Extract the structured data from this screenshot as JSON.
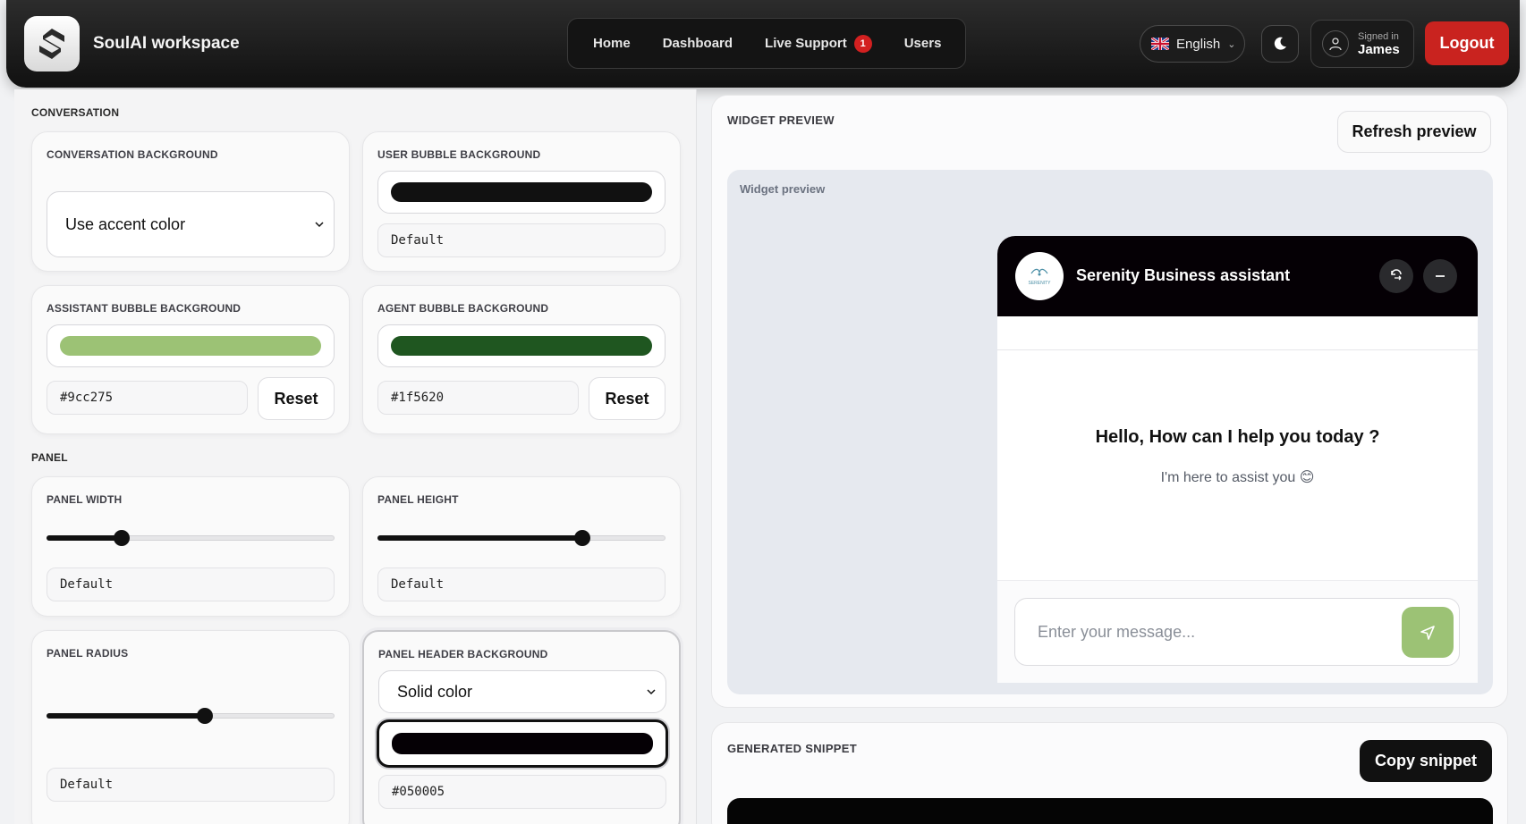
{
  "header": {
    "brand": "SoulAI workspace",
    "nav": [
      {
        "label": "Home"
      },
      {
        "label": "Dashboard"
      },
      {
        "label": "Live Support",
        "badge": "1"
      },
      {
        "label": "Users"
      }
    ],
    "language": "English",
    "signed_in_label": "Signed in",
    "user_name": "James",
    "logout": "Logout"
  },
  "conversation": {
    "section_title": "CONVERSATION",
    "conversation_background": {
      "label": "CONVERSATION BACKGROUND",
      "selected": "Use accent color"
    },
    "user_bubble": {
      "label": "USER BUBBLE BACKGROUND",
      "color": "#111111",
      "value": "Default"
    },
    "assistant_bubble": {
      "label": "ASSISTANT BUBBLE BACKGROUND",
      "color": "#9cc275",
      "value": "#9cc275",
      "reset": "Reset"
    },
    "agent_bubble": {
      "label": "AGENT BUBBLE BACKGROUND",
      "color": "#1f5620",
      "value": "#1f5620",
      "reset": "Reset"
    }
  },
  "panel": {
    "section_title": "PANEL",
    "width": {
      "label": "PANEL WIDTH",
      "value": "Default",
      "level": 0.26
    },
    "height": {
      "label": "PANEL HEIGHT",
      "value": "Default",
      "level": 0.71
    },
    "radius": {
      "label": "PANEL RADIUS",
      "value": "Default",
      "level": 0.55
    },
    "header_background": {
      "label": "PANEL HEADER BACKGROUND",
      "selected": "Solid color",
      "color": "#050005",
      "value": "#050005"
    }
  },
  "preview": {
    "title": "WIDGET PREVIEW",
    "refresh": "Refresh preview",
    "area_label": "Widget preview",
    "widget": {
      "title": "Serenity Business assistant",
      "avatar_text": "SERENITY",
      "greeting": "Hello, How can I help you today ?",
      "subtext": "I'm here to assist you 😊",
      "input_placeholder": "Enter your message..."
    }
  },
  "snippet": {
    "title": "GENERATED SNIPPET",
    "copy": "Copy snippet"
  },
  "colors": {
    "accent_green": "#9cc275",
    "logout_red": "#c9231f",
    "dark": "#111111"
  }
}
